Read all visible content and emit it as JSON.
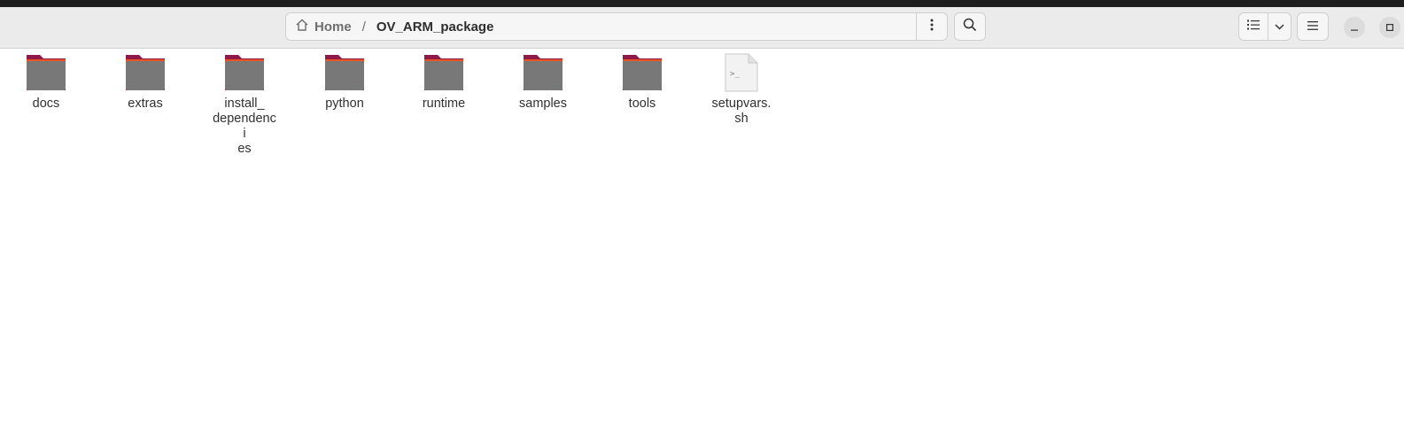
{
  "header": {
    "breadcrumb": {
      "home": "Home",
      "separator": "/",
      "current": "OV_ARM_package"
    },
    "icons": {
      "home": "home-icon",
      "path_menu": "kebab-menu-icon",
      "search": "search-icon",
      "list_view": "list-view-icon",
      "view_options": "chevron-down-icon",
      "main_menu": "hamburger-menu-icon",
      "minimize": "minimize-icon",
      "maximize": "maximize-icon"
    }
  },
  "files": [
    {
      "name": "docs",
      "type": "folder"
    },
    {
      "name": "extras",
      "type": "folder"
    },
    {
      "name": "install_\ndependenci\nes",
      "type": "folder"
    },
    {
      "name": "python",
      "type": "folder"
    },
    {
      "name": "runtime",
      "type": "folder"
    },
    {
      "name": "samples",
      "type": "folder"
    },
    {
      "name": "tools",
      "type": "folder"
    },
    {
      "name": "setupvars.\nsh",
      "type": "script"
    }
  ],
  "colors": {
    "folder_body": "#787878",
    "folder_tab": "#8f1a4a",
    "folder_accent": "#e95420",
    "headerbar": "#ebebeb"
  }
}
